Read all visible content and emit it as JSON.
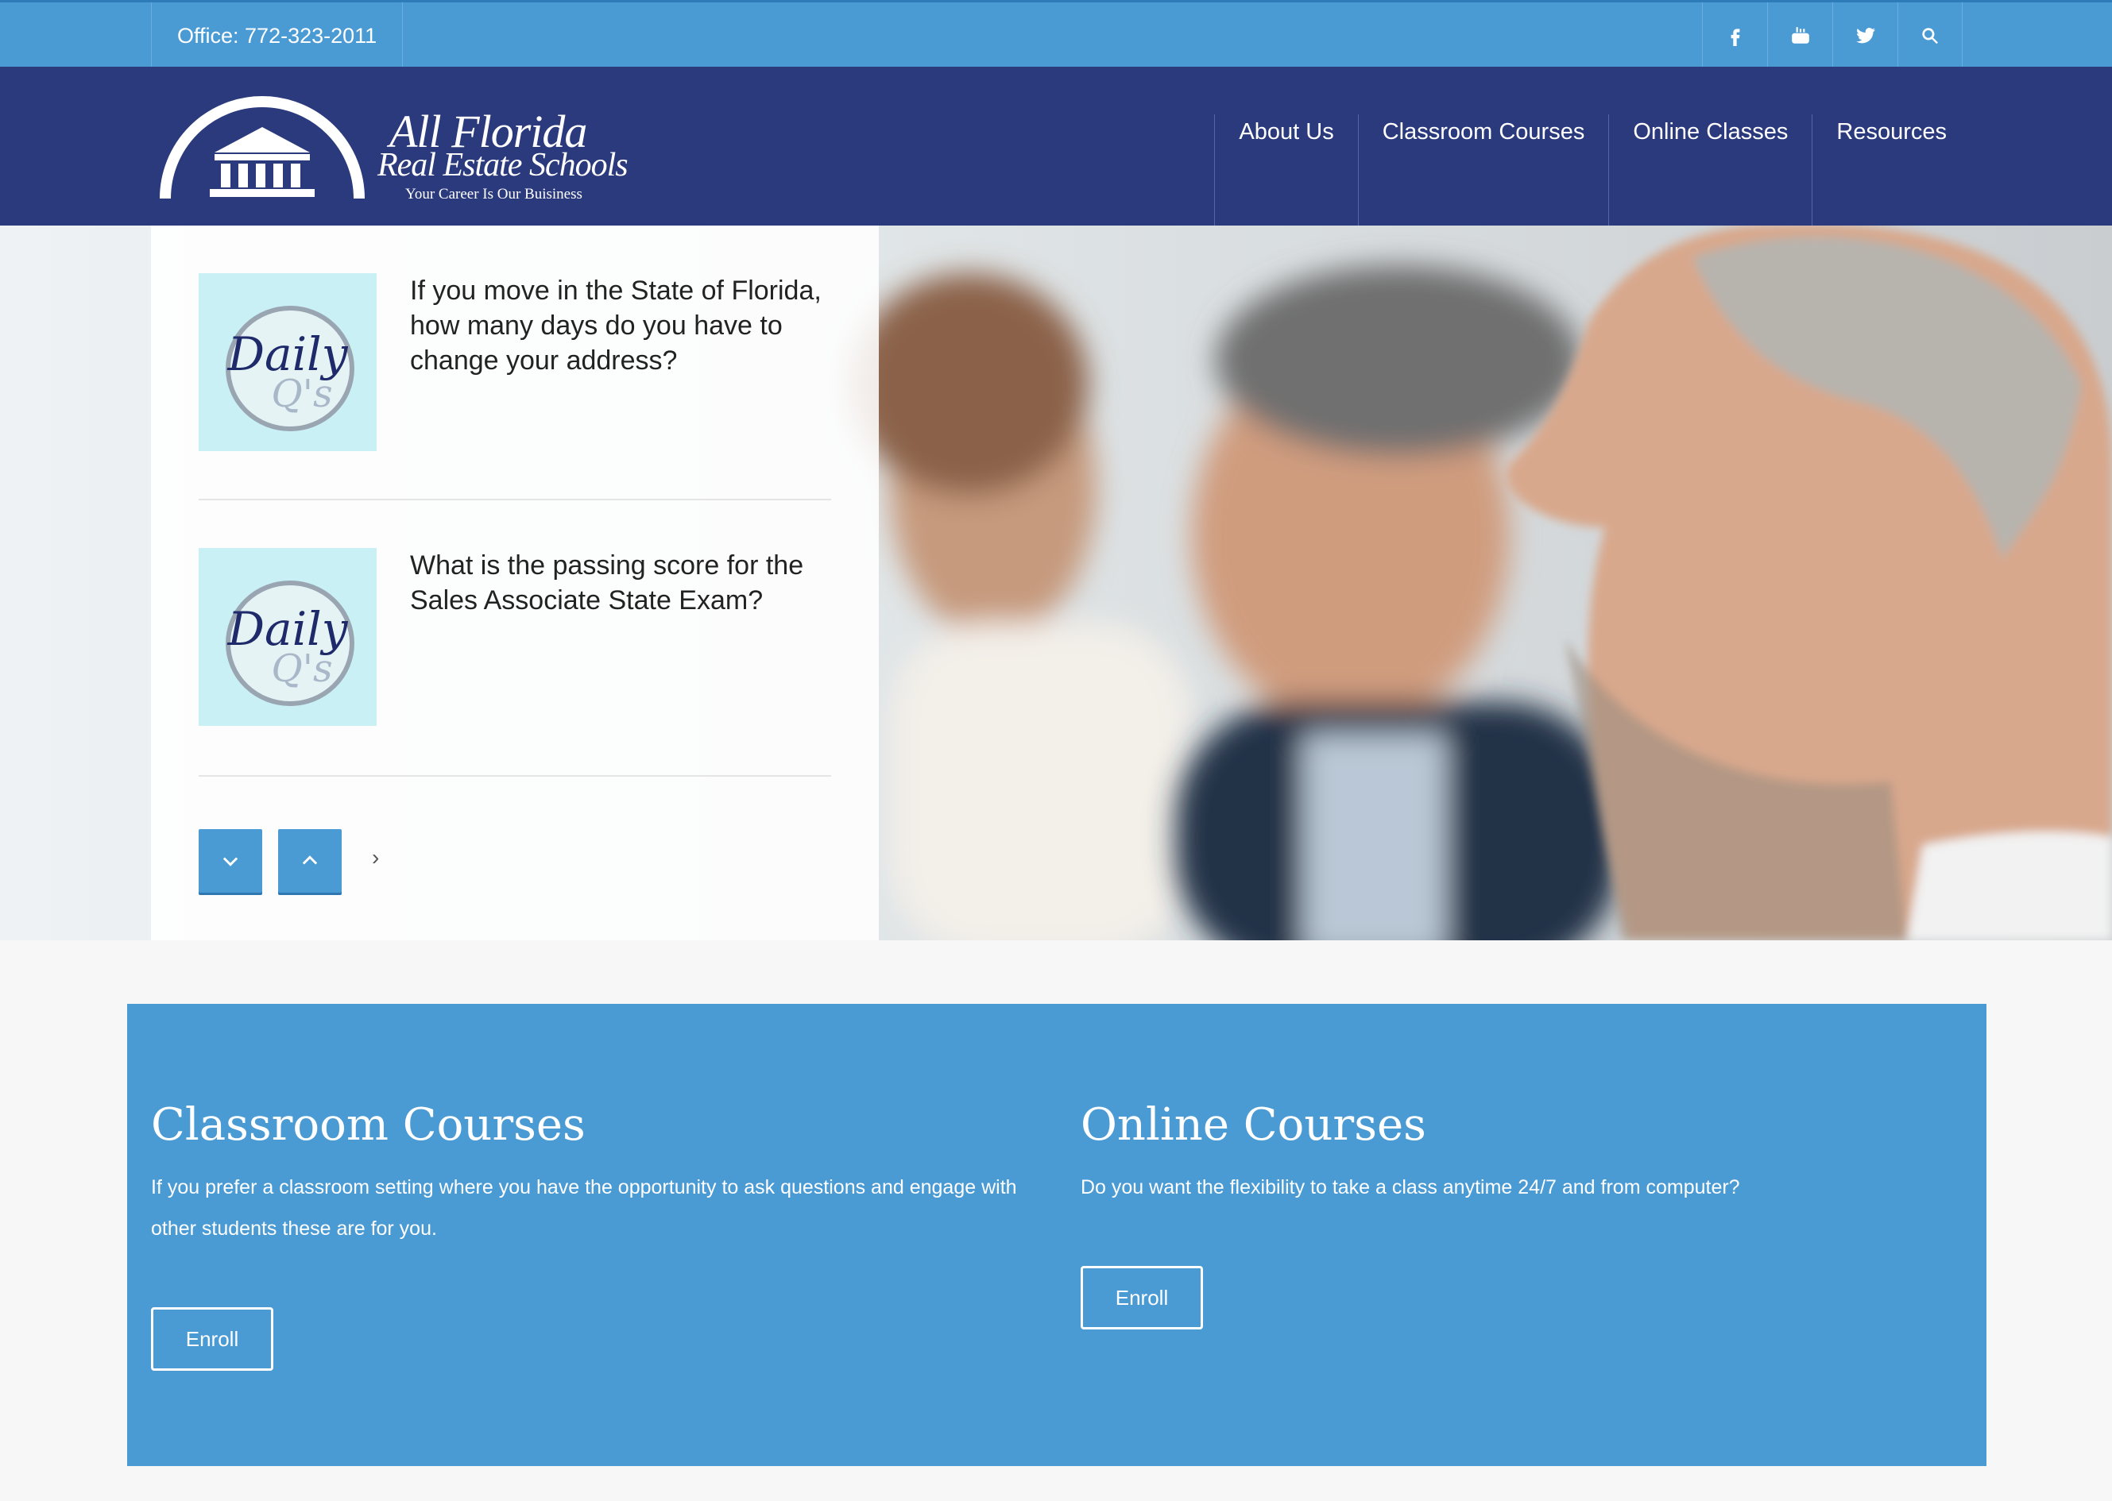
{
  "topbar": {
    "office": "Office: 772-323-2011",
    "social": [
      "facebook-icon",
      "youtube-icon",
      "twitter-icon",
      "search-icon"
    ]
  },
  "logo": {
    "line1": "All Florida",
    "line2": "Real Estate Schools",
    "tagline": "Your Career Is Our Buisiness"
  },
  "nav": {
    "items": [
      {
        "label": "About Us"
      },
      {
        "label": "Classroom Courses"
      },
      {
        "label": "Online Classes"
      },
      {
        "label": "Resources"
      }
    ]
  },
  "daily_questions": {
    "thumb_text": "Daily Q's",
    "items": [
      {
        "question": "If you move in the State of Florida, how many days do you have to change your address?"
      },
      {
        "question": "What is the passing score for the Sales Associate State Exam?"
      }
    ],
    "next_glyph": "›"
  },
  "courses": {
    "classroom": {
      "title": "Classroom Courses",
      "description": "If you prefer a classroom setting where you have the opportunity to ask questions and engage with other students these are for you.",
      "button": "Enroll"
    },
    "online": {
      "title": "Online Courses",
      "description": "Do you want the flexibility to take a class anytime 24/7 and from computer?",
      "button": "Enroll"
    }
  },
  "colors": {
    "topbar": "#4a9ad4",
    "header": "#2b3a7c",
    "accent": "#4a9ad4"
  }
}
